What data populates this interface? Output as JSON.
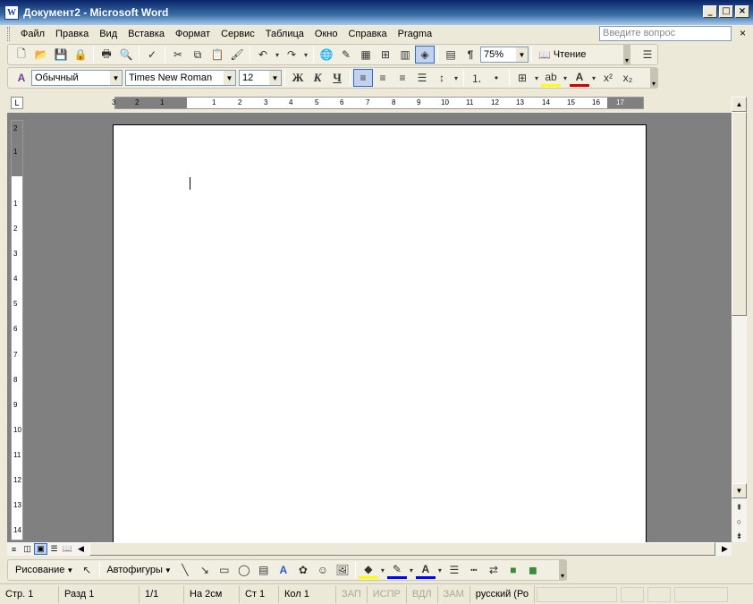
{
  "window": {
    "title": "Документ2 - Microsoft Word",
    "icon_glyph": "W"
  },
  "menu": {
    "items": [
      "Файл",
      "Правка",
      "Вид",
      "Вставка",
      "Формат",
      "Сервис",
      "Таблица",
      "Окно",
      "Справка",
      "Pragma"
    ],
    "help_placeholder": "Введите вопрос",
    "close_glyph": "×"
  },
  "standard_toolbar": {
    "zoom": "75%",
    "read_label": "Чтение"
  },
  "format_toolbar": {
    "style": "Обычный",
    "font": "Times New Roman",
    "size": "12",
    "bold": "Ж",
    "italic": "К",
    "underline": "Ч"
  },
  "ruler": {
    "h_ticks": [
      "3",
      "2",
      "1",
      "1",
      "2",
      "3",
      "4",
      "5",
      "6",
      "7",
      "8",
      "9",
      "10",
      "11",
      "12",
      "13",
      "14",
      "15",
      "16",
      "17"
    ],
    "v_ticks": [
      "2",
      "1",
      "1",
      "2",
      "3",
      "4",
      "5",
      "6",
      "7",
      "8",
      "9",
      "10",
      "11",
      "12",
      "13",
      "14"
    ]
  },
  "drawing_toolbar": {
    "draw_label": "Рисование",
    "autoshapes_label": "Автофигуры"
  },
  "status": {
    "page": "Стр. 1",
    "section": "Разд 1",
    "pages": "1/1",
    "at": "На 2см",
    "line": "Ст 1",
    "col": "Кол 1",
    "rec": "ЗАП",
    "trk": "ИСПР",
    "ext": "ВДЛ",
    "ovr": "ЗАМ",
    "language": "русский (Ро"
  },
  "colors": {
    "title_start": "#0a246a",
    "title_end": "#a6caf0",
    "workspace": "#808080",
    "chrome": "#ece9d8"
  }
}
